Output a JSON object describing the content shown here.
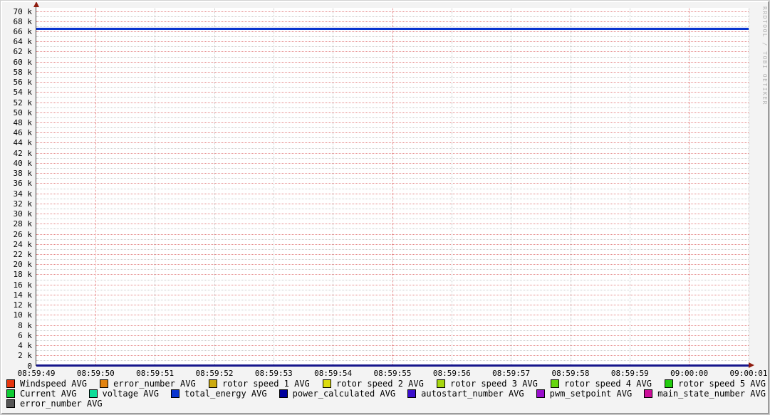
{
  "watermark": "RRDTOOL / TOBI OETIKER",
  "chart_data": {
    "type": "line",
    "title": "",
    "x_axis": {
      "tick_labels": [
        "08:59:49",
        "08:59:50",
        "08:59:51",
        "08:59:52",
        "08:59:53",
        "08:59:54",
        "08:59:55",
        "08:59:56",
        "08:59:57",
        "08:59:58",
        "08:59:59",
        "09:00:00",
        "09:00:01"
      ],
      "major_tick_labels": [
        "08:59:50",
        "08:59:55",
        "09:00:00"
      ]
    },
    "y_axis": {
      "min": 0,
      "max": 70000,
      "major_step": 2000,
      "minor_step": 1000,
      "unit": "k",
      "zero_label": "0"
    },
    "grid": {
      "major_color": "#e58888",
      "minor_color": "#cbcbcb"
    },
    "axis_color": "#404040",
    "arrow_color": "#8f1d10",
    "x_axis_line_color": "#16168c",
    "series": [
      {
        "name": "Windspeed AVG",
        "color": "#e6350e",
        "value": 0
      },
      {
        "name": "error_number AVG",
        "color": "#e2820e",
        "value": 0
      },
      {
        "name": "rotor speed 1 AVG",
        "color": "#ccaa0e",
        "value": 0
      },
      {
        "name": "rotor speed 2 AVG",
        "color": "#dcdc0e",
        "value": 0
      },
      {
        "name": "rotor speed 3 AVG",
        "color": "#a6d60e",
        "value": 0
      },
      {
        "name": "rotor speed 4 AVG",
        "color": "#66d60e",
        "value": 0
      },
      {
        "name": "rotor speed 5 AVG",
        "color": "#22cc0e",
        "value": 0
      },
      {
        "name": "Current AVG",
        "color": "#0ecc33",
        "value": 0
      },
      {
        "name": "voltage AVG",
        "color": "#0edd99",
        "value": 0
      },
      {
        "name": "total_energy AVG",
        "color": "#0a35d0",
        "value": 66600
      },
      {
        "name": "power_calculated AVG",
        "color": "#00009b",
        "value": 0
      },
      {
        "name": "autostart_number AVG",
        "color": "#3a0ecc",
        "value": 0
      },
      {
        "name": "pwm_setpoint AVG",
        "color": "#990ecc",
        "value": 0
      },
      {
        "name": "main_state_number AVG",
        "color": "#cc0e99",
        "value": 0
      },
      {
        "name": "error_number AVG",
        "color": "#555555",
        "value": 0
      }
    ],
    "legend_rows": [
      7,
      7,
      1
    ],
    "legend_suffixless": false
  }
}
